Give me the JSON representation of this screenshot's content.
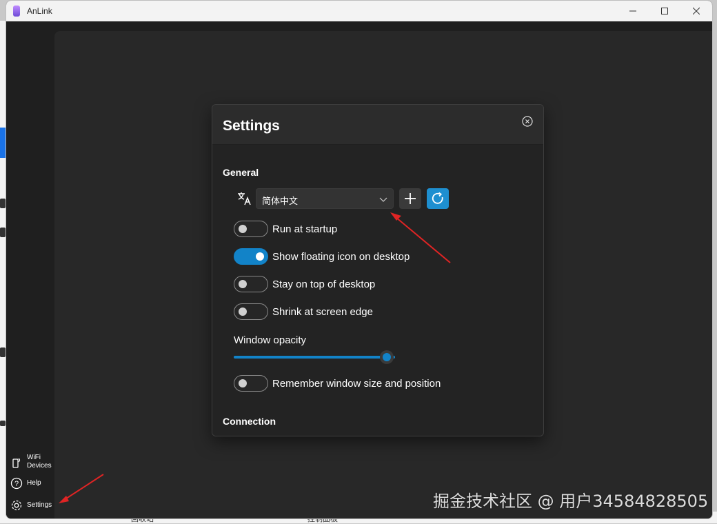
{
  "window": {
    "title": "AnLink"
  },
  "sidebar": {
    "items": [
      {
        "label_line1": "WiFi",
        "label_line2": "Devices",
        "icon": "phone-wifi-icon"
      },
      {
        "label": "Help",
        "icon": "help-icon"
      },
      {
        "label": "Settings",
        "icon": "gear-icon"
      }
    ]
  },
  "dialog": {
    "title": "Settings",
    "general": {
      "title": "General",
      "language": {
        "value": "简体中文"
      },
      "toggles": [
        {
          "label": "Run at startup",
          "on": false
        },
        {
          "label": "Show floating icon on desktop",
          "on": true
        },
        {
          "label": "Stay on top of desktop",
          "on": false
        },
        {
          "label": "Shrink at screen edge",
          "on": false
        }
      ],
      "opacity": {
        "label": "Window opacity",
        "value": 0.95
      },
      "remember": {
        "label": "Remember window size and position",
        "on": false
      }
    },
    "connection": {
      "title": "Connection"
    }
  },
  "desktop": {
    "bottom_left": "回收站",
    "bottom_right": "控制面板"
  },
  "watermark": "掘金技术社区 @ 用户34584828505",
  "colors": {
    "accent": "#1283c8",
    "arrow": "#e02424"
  }
}
